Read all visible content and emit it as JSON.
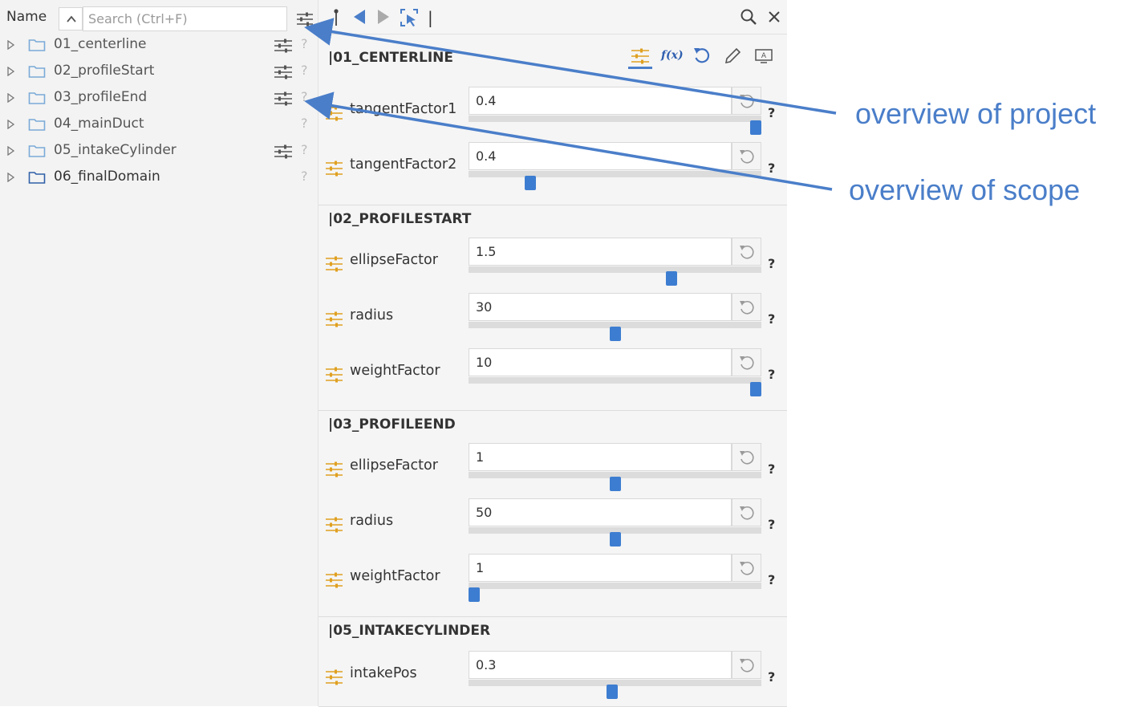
{
  "tree": {
    "header_label": "Name",
    "search_placeholder": "Search (Ctrl+F)",
    "items": [
      {
        "label": "01_centerline",
        "has_params": true
      },
      {
        "label": "02_profileStart",
        "has_params": true
      },
      {
        "label": "03_profileEnd",
        "has_params": true
      },
      {
        "label": "04_mainDuct",
        "has_params": false
      },
      {
        "label": "05_intakeCylinder",
        "has_params": true
      },
      {
        "label": "06_finalDomain",
        "has_params": false
      }
    ],
    "help_glyph": "?"
  },
  "toolbar": {
    "separator": "|",
    "icons": [
      "pin-icon",
      "previous-icon",
      "next-icon",
      "select-scope-icon",
      "search-icon",
      "close-icon"
    ]
  },
  "section_tools": {
    "function_label": "f(x)",
    "icons": [
      "parameters-icon",
      "function-icon",
      "reset-icon",
      "edit-icon",
      "display-icon"
    ]
  },
  "sections": [
    {
      "title": "|01_CENTERLINE",
      "params": [
        {
          "name": "tangentFactor1",
          "value": "0.4",
          "slider": 1.0
        },
        {
          "name": "tangentFactor2",
          "value": "0.4",
          "slider": 0.2
        }
      ]
    },
    {
      "title": "|02_PROFILESTART",
      "params": [
        {
          "name": "ellipseFactor",
          "value": "1.5",
          "slider": 0.7
        },
        {
          "name": "radius",
          "value": "30",
          "slider": 0.5
        },
        {
          "name": "weightFactor",
          "value": "10",
          "slider": 1.0
        }
      ]
    },
    {
      "title": "|03_PROFILEEND",
      "params": [
        {
          "name": "ellipseFactor",
          "value": "1",
          "slider": 0.5
        },
        {
          "name": "radius",
          "value": "50",
          "slider": 0.5
        },
        {
          "name": "weightFactor",
          "value": "1",
          "slider": 0.0
        }
      ]
    },
    {
      "title": "|05_INTAKECYLINDER",
      "params": [
        {
          "name": "intakePos",
          "value": "0.3",
          "slider": 0.49
        }
      ]
    }
  ],
  "param_help_glyph": "?",
  "annotations": {
    "project": "overview of project",
    "scope": "overview of scope"
  },
  "colors": {
    "accent": "#4a7ec9",
    "slider_thumb": "#3d7dd1",
    "param_icon": "#e0a020",
    "folder": "#7aaad8"
  }
}
